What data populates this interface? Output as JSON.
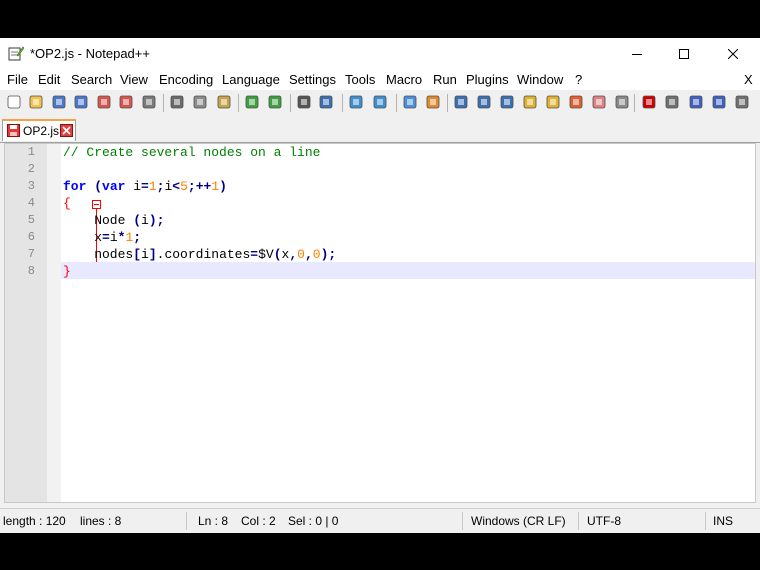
{
  "window": {
    "title": "*OP2.js - Notepad++",
    "menu_close": "X"
  },
  "menu": [
    "File",
    "Edit",
    "Search",
    "View",
    "Encoding",
    "Language",
    "Settings",
    "Tools",
    "Macro",
    "Run",
    "Plugins",
    "Window",
    "?"
  ],
  "toolbar_icons": [
    "new-file-icon",
    "open-file-icon",
    "save-icon",
    "save-all-icon",
    "close-icon",
    "close-all-icon",
    "print-icon",
    "cut-icon",
    "copy-icon",
    "paste-icon",
    "undo-icon",
    "redo-icon",
    "find-icon",
    "replace-icon",
    "zoom-in-icon",
    "zoom-out-icon",
    "sync-vertical-icon",
    "sync-horizontal-icon",
    "word-wrap-icon",
    "show-all-chars-icon",
    "indent-guide-icon",
    "user-language-icon",
    "doc-map-icon",
    "function-list-icon",
    "folder-workspace-icon",
    "monitoring-icon",
    "record-macro-icon",
    "stop-record-icon",
    "play-macro-icon",
    "run-macro-multiple-icon",
    "save-macro-icon"
  ],
  "tab": {
    "label": "OP2.js"
  },
  "editor": {
    "line_numbers": [
      "1",
      "2",
      "3",
      "4",
      "5",
      "6",
      "7",
      "8"
    ],
    "lines": [
      [
        {
          "t": "// Create several nodes on a line",
          "c": "cm"
        }
      ],
      [],
      [
        {
          "t": "for",
          "c": "kw"
        },
        {
          "t": " "
        },
        {
          "t": "(",
          "c": "op"
        },
        {
          "t": "var",
          "c": "kw"
        },
        {
          "t": " i"
        },
        {
          "t": "=",
          "c": "op"
        },
        {
          "t": "1",
          "c": "num"
        },
        {
          "t": ";",
          "c": "op"
        },
        {
          "t": "i"
        },
        {
          "t": "<",
          "c": "op"
        },
        {
          "t": "5",
          "c": "num"
        },
        {
          "t": ";++",
          "c": "op"
        },
        {
          "t": "1",
          "c": "num"
        },
        {
          "t": ")",
          "c": "op"
        }
      ],
      [
        {
          "t": "{",
          "c": "br"
        }
      ],
      [
        {
          "t": "    Node "
        },
        {
          "t": "(",
          "c": "op"
        },
        {
          "t": "i"
        },
        {
          "t": ");",
          "c": "op"
        }
      ],
      [
        {
          "t": "    x"
        },
        {
          "t": "=",
          "c": "op"
        },
        {
          "t": "i"
        },
        {
          "t": "*",
          "c": "op"
        },
        {
          "t": "1",
          "c": "num"
        },
        {
          "t": ";",
          "c": "op"
        }
      ],
      [
        {
          "t": "    nodes"
        },
        {
          "t": "[",
          "c": "op"
        },
        {
          "t": "i"
        },
        {
          "t": "]",
          "c": "op"
        },
        {
          "t": ".coordinates"
        },
        {
          "t": "=",
          "c": "op"
        },
        {
          "t": "$V"
        },
        {
          "t": "(",
          "c": "op"
        },
        {
          "t": "x"
        },
        {
          "t": ",",
          "c": "op"
        },
        {
          "t": "0",
          "c": "num"
        },
        {
          "t": ",",
          "c": "op"
        },
        {
          "t": "0",
          "c": "num"
        },
        {
          "t": ");",
          "c": "op"
        }
      ],
      [
        {
          "t": "}",
          "c": "br"
        }
      ]
    ]
  },
  "status": {
    "length": "length : 120",
    "lines": "lines : 8",
    "ln": "Ln : 8",
    "col": "Col : 2",
    "sel": "Sel : 0 | 0",
    "eol": "Windows (CR LF)",
    "encoding": "UTF-8",
    "mode": "INS"
  }
}
